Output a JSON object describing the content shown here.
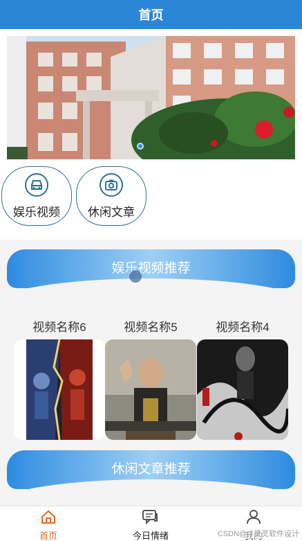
{
  "header": {
    "title": "首页"
  },
  "banner": {
    "alt": "campus-building-photo"
  },
  "categories": [
    {
      "label": "娱乐视频",
      "icon": "car-icon"
    },
    {
      "label": "休闲文章",
      "icon": "camera-icon"
    }
  ],
  "sections": {
    "video_title": "娱乐视频推荐",
    "article_title": "休闲文章推荐"
  },
  "videos": [
    {
      "title": "视频名称6"
    },
    {
      "title": "视频名称5"
    },
    {
      "title": "视频名称4"
    }
  ],
  "tabbar": {
    "items": [
      {
        "label": "首页",
        "icon": "home-icon",
        "active": true
      },
      {
        "label": "今日情绪",
        "icon": "chat-icon",
        "active": false
      },
      {
        "label": "我的",
        "icon": "user-icon",
        "active": false
      }
    ]
  },
  "watermark": "CSDN@IT灵灵软件设计",
  "colors": {
    "primary": "#2c86d8",
    "active_tab": "#e2681f"
  }
}
